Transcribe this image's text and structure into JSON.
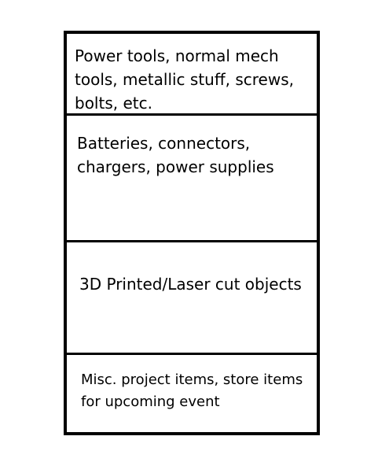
{
  "compartments": [
    {
      "label": "Power tools, normal mech tools, metallic stuff, screws, bolts, etc."
    },
    {
      "label": "Batteries, connectors, chargers, power supplies"
    },
    {
      "label": "3D Printed/Laser cut objects"
    },
    {
      "label": "Misc. project items, store items for upcoming event"
    }
  ],
  "colors": {
    "border": "#000000",
    "background": "#ffffff",
    "text": "#000000"
  }
}
